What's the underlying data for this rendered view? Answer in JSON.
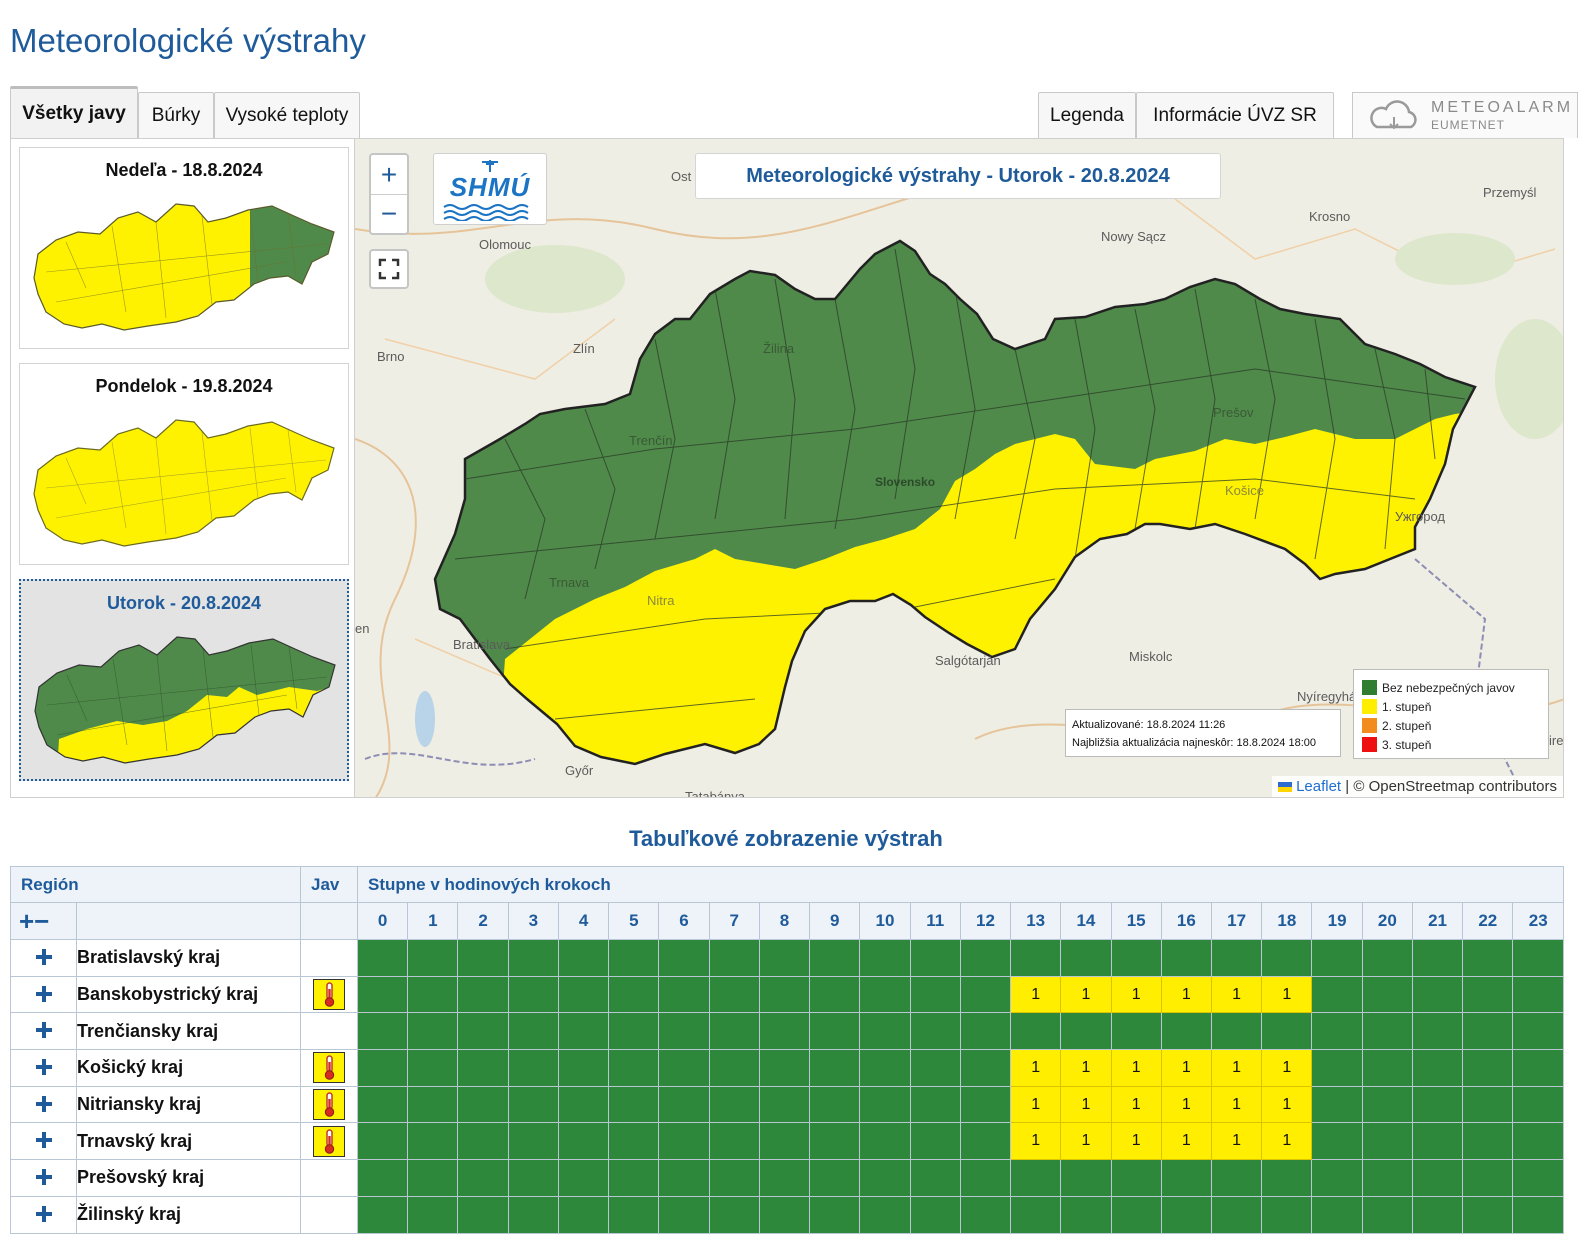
{
  "page": {
    "title": "Meteorologické výstrahy"
  },
  "tabs": [
    {
      "label": "Všetky javy",
      "active": true
    },
    {
      "label": "Búrky",
      "active": false
    },
    {
      "label": "Vysoké teploty",
      "active": false
    }
  ],
  "right_tabs": [
    {
      "label": "Legenda"
    },
    {
      "label": "Informácie ÚVZ SR"
    }
  ],
  "meteoalarm": {
    "name": "METEOALARM",
    "sub": "EUMETNET",
    "icon": "cloud-icon"
  },
  "days": [
    {
      "label": "Nedeľa - 18.8.2024",
      "selected": false,
      "map": "mostly-yellow-east-green"
    },
    {
      "label": "Pondelok - 19.8.2024",
      "selected": false,
      "map": "all-yellow"
    },
    {
      "label": "Utorok - 20.8.2024",
      "selected": true,
      "map": "north-green-south-yellow"
    }
  ],
  "map": {
    "title": "Meteorologické výstrahy - Utorok - 20.8.2024",
    "zoom_in": "+",
    "zoom_out": "−",
    "logo_text": "SHMÚ",
    "towns": [
      "Ost",
      "Olomouc",
      "Nowy Sącz",
      "Krosno",
      "Przemyśl",
      "Brno",
      "Zlín",
      "Žilina",
      "Trenčín",
      "Prešov",
      "Slovensko",
      "Košice",
      "Ужгород",
      "Trnava",
      "Nitra",
      "Bratislava",
      "Salgótarján",
      "Miskolc",
      "Nyíregyhá",
      "Győr",
      "Tatabánya",
      "en",
      "ire"
    ],
    "update": {
      "updated": "Aktualizované: 18.8.2024 11:26",
      "next": "Najbližšia aktualizácia najneskôr: 18.8.2024 18:00"
    },
    "legend": [
      {
        "label": "Bez nebezpečných javov",
        "color": "#2f7d31"
      },
      {
        "label": "1. stupeň",
        "color": "#ffee00"
      },
      {
        "label": "2. stupeň",
        "color": "#f28c1e"
      },
      {
        "label": "3. stupeň",
        "color": "#ee1010"
      }
    ],
    "attribution": {
      "leaflet": "Leaflet",
      "sep": " | ",
      "osm": "© OpenStreetmap contributors"
    }
  },
  "table": {
    "title": "Tabuľkové zobrazenie výstrah",
    "headers": {
      "region": "Región",
      "jav": "Jav",
      "steps": "Stupne v hodinových krokoch",
      "expand_collapse": "+−"
    },
    "hours": [
      "0",
      "1",
      "2",
      "3",
      "4",
      "5",
      "6",
      "7",
      "8",
      "9",
      "10",
      "11",
      "12",
      "13",
      "14",
      "15",
      "16",
      "17",
      "18",
      "19",
      "20",
      "21",
      "22",
      "23"
    ],
    "rows": [
      {
        "name": "Bratislavský kraj",
        "icon": null,
        "levels": [
          0,
          0,
          0,
          0,
          0,
          0,
          0,
          0,
          0,
          0,
          0,
          0,
          0,
          0,
          0,
          0,
          0,
          0,
          0,
          0,
          0,
          0,
          0,
          0
        ]
      },
      {
        "name": "Banskobystrický kraj",
        "icon": "thermometer-icon",
        "levels": [
          0,
          0,
          0,
          0,
          0,
          0,
          0,
          0,
          0,
          0,
          0,
          0,
          0,
          1,
          1,
          1,
          1,
          1,
          1,
          0,
          0,
          0,
          0,
          0
        ]
      },
      {
        "name": "Trenčiansky kraj",
        "icon": null,
        "levels": [
          0,
          0,
          0,
          0,
          0,
          0,
          0,
          0,
          0,
          0,
          0,
          0,
          0,
          0,
          0,
          0,
          0,
          0,
          0,
          0,
          0,
          0,
          0,
          0
        ]
      },
      {
        "name": "Košický kraj",
        "icon": "thermometer-icon",
        "levels": [
          0,
          0,
          0,
          0,
          0,
          0,
          0,
          0,
          0,
          0,
          0,
          0,
          0,
          1,
          1,
          1,
          1,
          1,
          1,
          0,
          0,
          0,
          0,
          0
        ]
      },
      {
        "name": "Nitriansky kraj",
        "icon": "thermometer-icon",
        "levels": [
          0,
          0,
          0,
          0,
          0,
          0,
          0,
          0,
          0,
          0,
          0,
          0,
          0,
          1,
          1,
          1,
          1,
          1,
          1,
          0,
          0,
          0,
          0,
          0
        ]
      },
      {
        "name": "Trnavský kraj",
        "icon": "thermometer-icon",
        "levels": [
          0,
          0,
          0,
          0,
          0,
          0,
          0,
          0,
          0,
          0,
          0,
          0,
          0,
          1,
          1,
          1,
          1,
          1,
          1,
          0,
          0,
          0,
          0,
          0
        ]
      },
      {
        "name": "Prešovský kraj",
        "icon": null,
        "levels": [
          0,
          0,
          0,
          0,
          0,
          0,
          0,
          0,
          0,
          0,
          0,
          0,
          0,
          0,
          0,
          0,
          0,
          0,
          0,
          0,
          0,
          0,
          0,
          0
        ]
      },
      {
        "name": "Žilinský kraj",
        "icon": null,
        "levels": [
          0,
          0,
          0,
          0,
          0,
          0,
          0,
          0,
          0,
          0,
          0,
          0,
          0,
          0,
          0,
          0,
          0,
          0,
          0,
          0,
          0,
          0,
          0,
          0
        ]
      }
    ]
  },
  "colors": {
    "accent": "#1f5b9a",
    "green": "#2d883b",
    "yellow": "#ffee00",
    "map_green": "#4f8a4a",
    "map_yellow": "#fff200"
  }
}
